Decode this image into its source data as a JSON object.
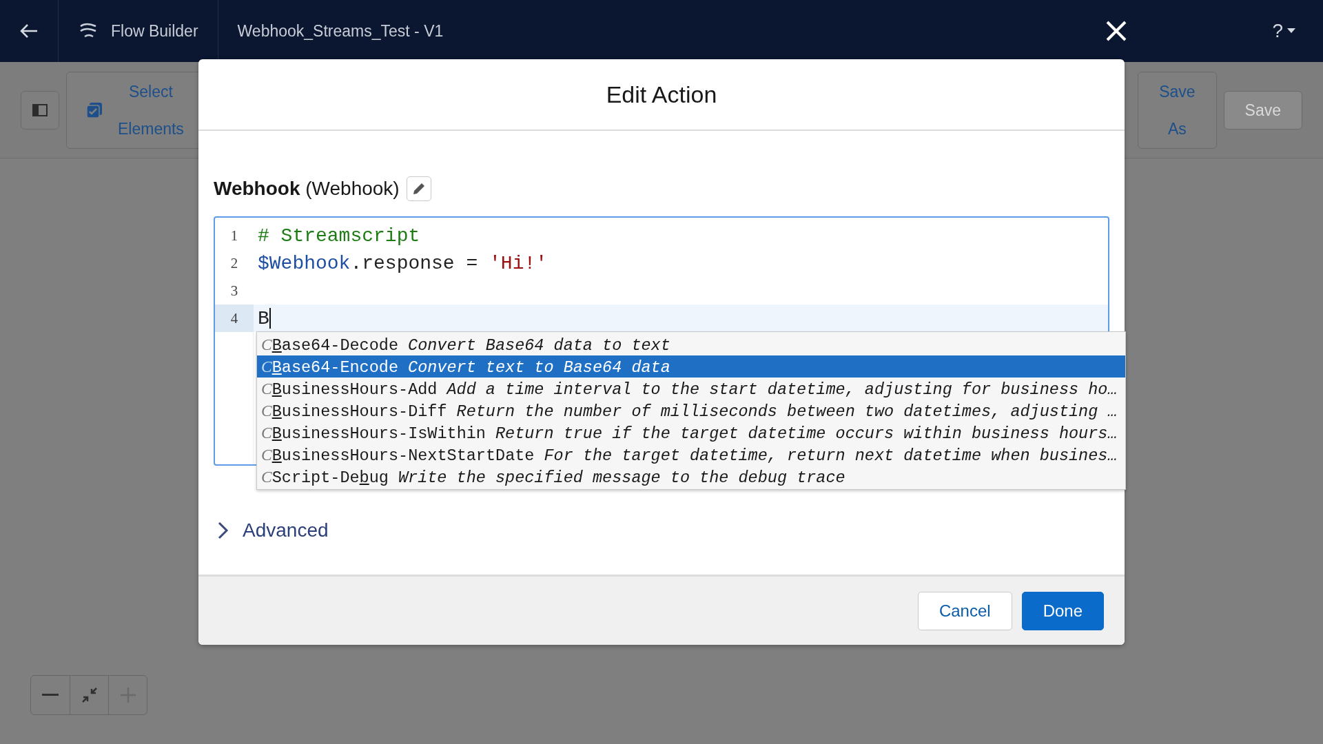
{
  "header": {
    "app_name": "Flow Builder",
    "flow_title": "Webhook_Streams_Test - V1",
    "help_label": "?"
  },
  "toolbar": {
    "select_button": [
      "Select",
      "Elements"
    ],
    "save_as_button": [
      "Save",
      "As"
    ],
    "save_button": {
      "label": "Save",
      "disabled": true
    }
  },
  "zoom_controls": [
    {
      "kind": "zoom-out",
      "disabled": false
    },
    {
      "kind": "fit",
      "disabled": false
    },
    {
      "kind": "zoom-in",
      "disabled": true
    }
  ],
  "modal": {
    "title": "Edit Action",
    "action_name": "Webhook",
    "action_type": "(Webhook)",
    "code_lines": [
      {
        "number": "1",
        "active": false,
        "tokens": [
          {
            "kind": "comment",
            "text": "# Streamscript"
          }
        ]
      },
      {
        "number": "2",
        "active": false,
        "tokens": [
          {
            "kind": "variable",
            "text": "$Webhook"
          },
          {
            "kind": "plain",
            "text": ".response = "
          },
          {
            "kind": "string",
            "text": "'Hi!'"
          }
        ]
      },
      {
        "number": "3",
        "active": false
      },
      {
        "number": "4",
        "active": true,
        "tokens": [
          {
            "kind": "plain",
            "text": "B"
          }
        ]
      }
    ],
    "suggestions": [
      {
        "glyph": "C",
        "name_match": "B",
        "name_after": "ase64-Decode",
        "description": "Convert Base64 data to text",
        "selected": false
      },
      {
        "glyph": "C",
        "name_match": "B",
        "name_after": "ase64-Encode",
        "description": "Convert text to Base64 data",
        "selected": true
      },
      {
        "glyph": "C",
        "name_match": "B",
        "name_after": "usinessHours-Add",
        "description": "Add a time interval to the start datetime, adjusting for business ho…",
        "selected": false
      },
      {
        "glyph": "C",
        "name_match": "B",
        "name_after": "usinessHours-Diff",
        "description": "Return the number of milliseconds between two datetimes, adjusting …",
        "selected": false
      },
      {
        "glyph": "C",
        "name_match": "B",
        "name_after": "usinessHours-IsWithin",
        "description": "Return true if the target datetime occurs within business hours…",
        "selected": false
      },
      {
        "glyph": "C",
        "name_match": "B",
        "name_after": "usinessHours-NextStartDate",
        "description": "For the target datetime, return next datetime when busines…",
        "selected": false
      },
      {
        "glyph": "C",
        "name_before": "Script-De",
        "name_match": "b",
        "name_after": "ug",
        "description": "Write the specified message to the debug trace",
        "selected": false
      }
    ],
    "advanced": {
      "label": "Advanced",
      "expanded": false
    },
    "buttons": [
      {
        "kind": "neutral",
        "label": "Cancel"
      },
      {
        "kind": "brand",
        "label": "Done"
      }
    ]
  }
}
